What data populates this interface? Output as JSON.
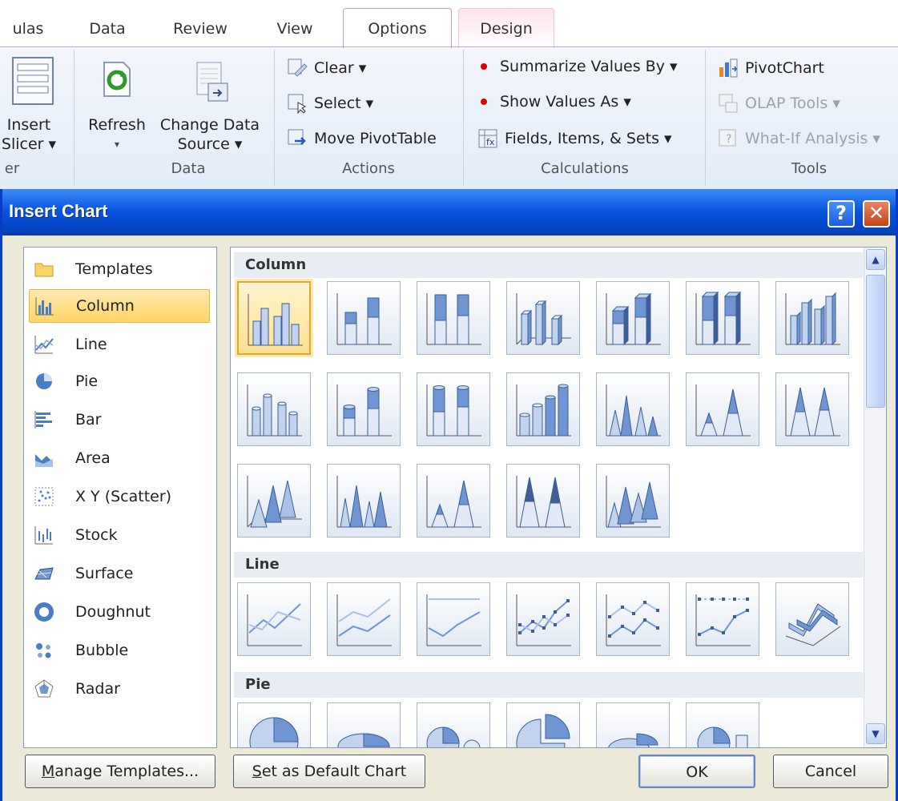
{
  "ribbon": {
    "tabs": [
      {
        "label": "ulas"
      },
      {
        "label": "Data"
      },
      {
        "label": "Review"
      },
      {
        "label": "View"
      },
      {
        "label": "Options"
      },
      {
        "label": "Design"
      }
    ],
    "insert_slicer": {
      "line1": "Insert",
      "line2": "Slicer ▾"
    },
    "group_fragment_label": "er",
    "refresh": {
      "label": "Refresh",
      "caret": "▾"
    },
    "change_data_source": {
      "line1": "Change Data",
      "line2": "Source ▾"
    },
    "data_group_label": "Data",
    "clear": "Clear ▾",
    "select": "Select ▾",
    "move_pivottable": "Move PivotTable",
    "actions_group_label": "Actions",
    "summarize_values_by": "Summarize Values By ▾",
    "show_values_as": "Show Values As ▾",
    "fields_items_sets": "Fields, Items, & Sets ▾",
    "calculations_group_label": "Calculations",
    "pivotchart": "PivotChart",
    "olap_tools": "OLAP Tools ▾",
    "what_if_analysis": "What-If Analysis ▾",
    "tools_group_label": "Tools"
  },
  "dialog": {
    "title": "Insert Chart",
    "help": "?",
    "close": "✕",
    "categories": [
      {
        "label": "Templates",
        "icon": "folder-icon"
      },
      {
        "label": "Column",
        "icon": "column-chart-icon",
        "selected": true
      },
      {
        "label": "Line",
        "icon": "line-chart-icon"
      },
      {
        "label": "Pie",
        "icon": "pie-chart-icon"
      },
      {
        "label": "Bar",
        "icon": "bar-chart-icon"
      },
      {
        "label": "Area",
        "icon": "area-chart-icon"
      },
      {
        "label": "X Y (Scatter)",
        "icon": "scatter-chart-icon"
      },
      {
        "label": "Stock",
        "icon": "stock-chart-icon"
      },
      {
        "label": "Surface",
        "icon": "surface-chart-icon"
      },
      {
        "label": "Doughnut",
        "icon": "doughnut-chart-icon"
      },
      {
        "label": "Bubble",
        "icon": "bubble-chart-icon"
      },
      {
        "label": "Radar",
        "icon": "radar-chart-icon"
      }
    ],
    "sections": {
      "column": "Column",
      "line": "Line",
      "pie": "Pie"
    },
    "buttons": {
      "manage_templates_u": "M",
      "manage_templates_rest": "anage Templates...",
      "set_default_u": "S",
      "set_default_rest": "et as Default Chart",
      "ok": "OK",
      "cancel": "Cancel"
    },
    "colors": {
      "titlebar": "#0a56e0",
      "selection": "#ffd565",
      "dialog_bg": "#ece9d8"
    }
  }
}
